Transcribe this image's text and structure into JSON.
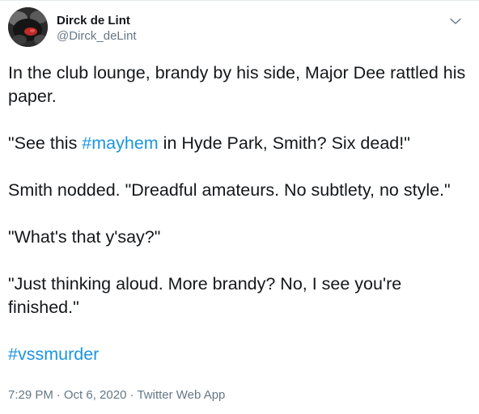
{
  "author": {
    "display_name": "Dirck de Lint",
    "handle": "@Dirck_deLint"
  },
  "tweet": {
    "p1": "In the club lounge, brandy by his side, Major Dee rattled his paper.",
    "p2_before": "\"See this ",
    "p2_hashtag": "#mayhem",
    "p2_after": " in Hyde Park, Smith? Six dead!\"",
    "p3": "Smith nodded. \"Dreadful amateurs. No subtlety, no style.\"",
    "p4": "\"What's that y'say?\"",
    "p5": "\"Just thinking aloud. More brandy? No, I see you're finished.\"",
    "hashtag": "#vssmurder"
  },
  "meta": {
    "time": "7:29 PM",
    "separator": "·",
    "date": "Oct 6, 2020",
    "source": "Twitter Web App"
  },
  "colors": {
    "text": "#14171a",
    "secondary": "#657786",
    "link": "#1b95e0"
  },
  "icons": {
    "caret": "chevron-down-icon"
  }
}
